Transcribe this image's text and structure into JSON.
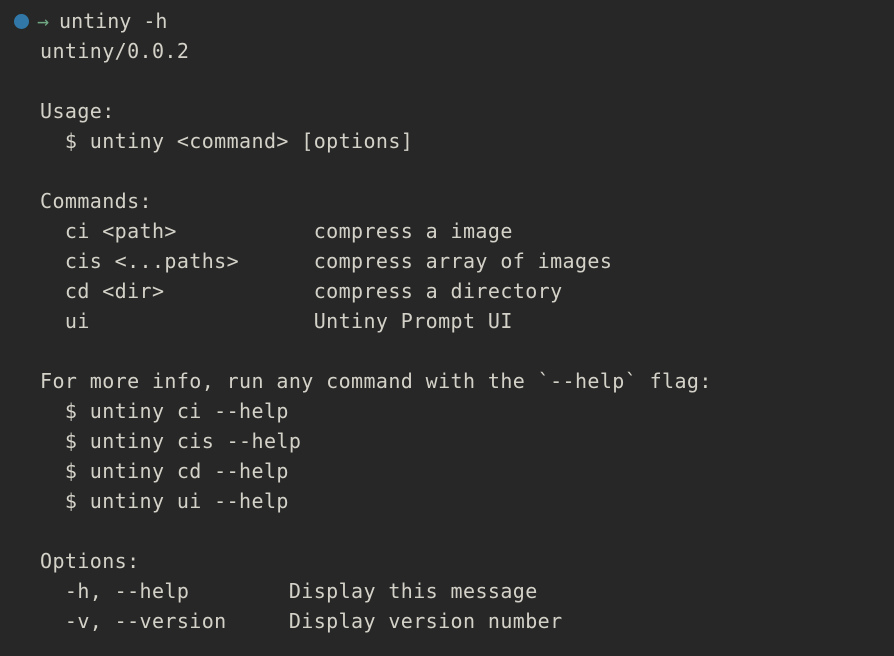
{
  "terminal": {
    "background_color": "#272727",
    "text_color": "#d4d2c8",
    "prompt": {
      "dot_color": "#3178a8",
      "arrow_color": "#6fa883",
      "arrow_glyph": "→",
      "command": "untiny -h"
    },
    "scrollback_remnant": "  ",
    "output": {
      "version_line": "untiny/0.0.2",
      "usage": {
        "heading": "Usage:",
        "line": "  $ untiny <command> [options]"
      },
      "commands": {
        "heading": "Commands:",
        "items": [
          {
            "name": "ci <path>",
            "description": "compress a image"
          },
          {
            "name": "cis <...paths>",
            "description": "compress array of images"
          },
          {
            "name": "cd <dir>",
            "description": "compress a directory"
          },
          {
            "name": "ui",
            "description": "Untiny Prompt UI"
          }
        ]
      },
      "more_info": {
        "heading": "For more info, run any command with the `--help` flag:",
        "lines": [
          "  $ untiny ci --help",
          "  $ untiny cis --help",
          "  $ untiny cd --help",
          "  $ untiny ui --help"
        ]
      },
      "options": {
        "heading": "Options:",
        "items": [
          {
            "flags": "-h, --help",
            "description": "Display this message"
          },
          {
            "flags": "-v, --version",
            "description": "Display version number"
          }
        ]
      }
    }
  }
}
